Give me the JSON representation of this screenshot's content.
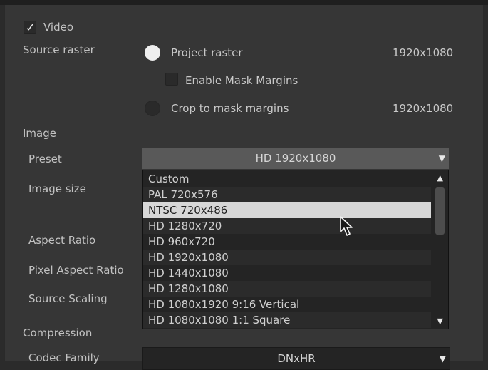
{
  "video": {
    "label": "Video",
    "checked": true
  },
  "source_raster": {
    "label": "Source raster",
    "options": [
      {
        "label": "Project raster",
        "value": "1920x1080",
        "selected": true
      },
      {
        "label": "Crop to mask margins",
        "value": "1920x1080",
        "selected": false
      }
    ],
    "enable_mask_margins": {
      "label": "Enable Mask Margins",
      "checked": false
    }
  },
  "image": {
    "section_label": "Image",
    "preset_label": "Preset",
    "preset_value": "HD 1920x1080",
    "image_size_label": "Image size",
    "aspect_ratio_label": "Aspect Ratio",
    "pixel_aspect_ratio_label": "Pixel Aspect Ratio",
    "source_scaling_label": "Source Scaling"
  },
  "preset_list": {
    "items": [
      "Custom",
      "PAL 720x576",
      "NTSC 720x486",
      "HD 1280x720",
      "HD 960x720",
      "HD 1920x1080",
      "HD 1440x1080",
      "HD 1280x1080",
      "HD 1080x1920 9:16 Vertical",
      "HD 1080x1080 1:1 Square"
    ],
    "highlighted": "NTSC 720x486"
  },
  "compression": {
    "section_label": "Compression",
    "codec_family_label": "Codec Family",
    "codec_family_value": "DNxHR"
  },
  "icons": {
    "check": "checkmark-icon",
    "dropdown": "triangle-down-icon",
    "scroll_up": "triangle-up-icon",
    "scroll_down": "triangle-down-icon",
    "cursor": "mouse-pointer-icon"
  },
  "colors": {
    "panel": "#363636",
    "dropdown": "#595959",
    "list_bg": "#242424",
    "list_selected": "#d7d7d7"
  }
}
